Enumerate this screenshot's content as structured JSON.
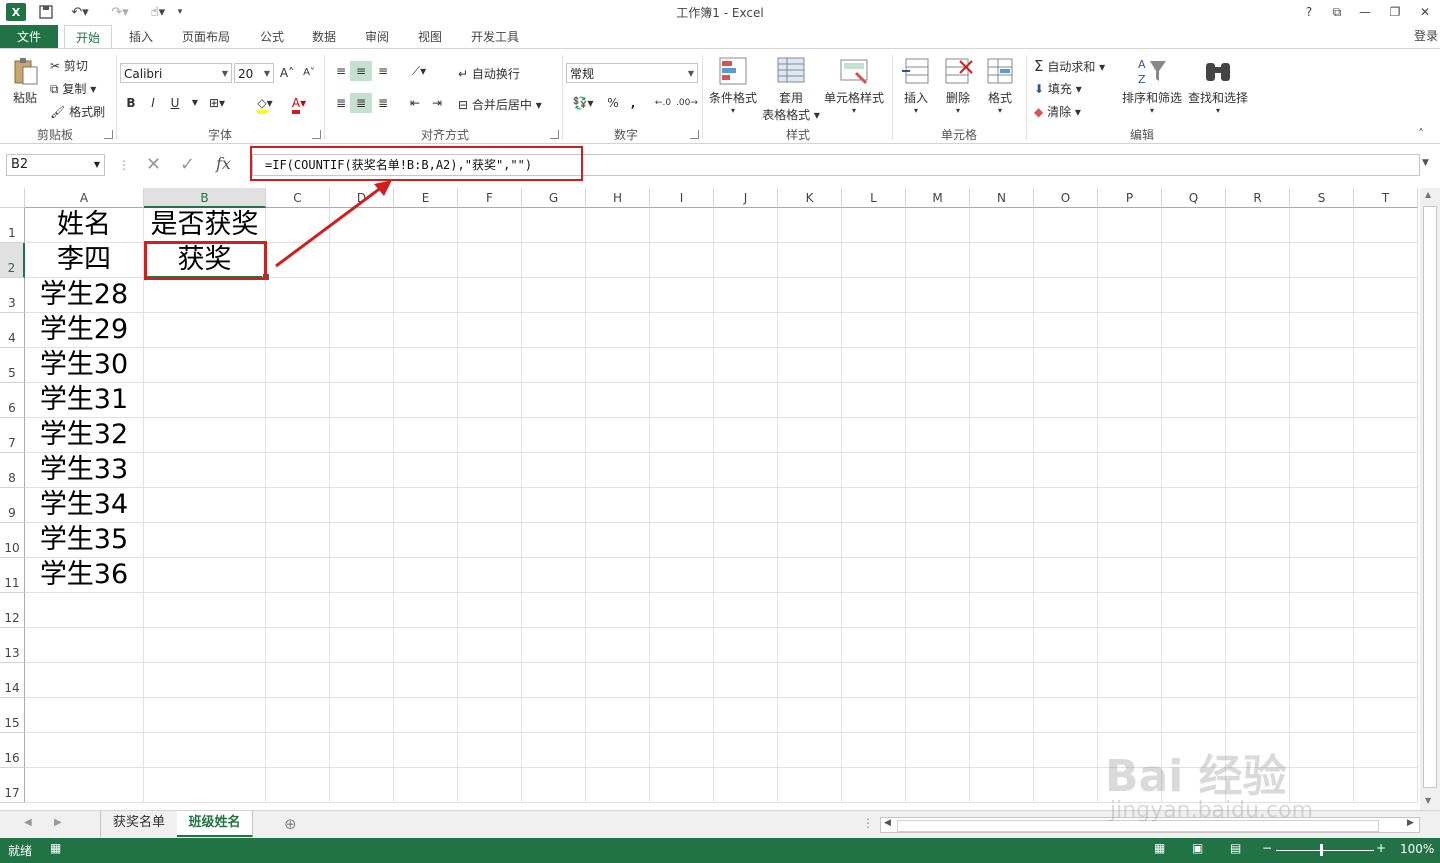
{
  "window": {
    "title": "工作簿1 - Excel",
    "help": "?",
    "login": "登录"
  },
  "tabs": [
    "文件",
    "开始",
    "插入",
    "页面布局",
    "公式",
    "数据",
    "审阅",
    "视图",
    "开发工具"
  ],
  "ribbon": {
    "clipboard": {
      "paste": "粘贴",
      "cut": "剪切",
      "copy": "复制",
      "format_painter": "格式刷",
      "label": "剪贴板"
    },
    "font": {
      "name": "Calibri",
      "size": "20",
      "bold": "B",
      "italic": "I",
      "underline": "U",
      "label": "字体",
      "grow": "A",
      "shrink": "A"
    },
    "alignment": {
      "wrap": "自动换行",
      "merge": "合并后居中",
      "label": "对齐方式"
    },
    "number": {
      "format": "常规",
      "percent": "%",
      "comma": ",",
      "label": "数字"
    },
    "styles": {
      "conditional": "条件格式",
      "table_line1": "套用",
      "table_line2": "表格格式",
      "cell_styles": "单元格样式",
      "label": "样式"
    },
    "cells": {
      "insert": "插入",
      "delete": "删除",
      "format": "格式",
      "label": "单元格"
    },
    "editing": {
      "autosum": "自动求和",
      "fill": "填充",
      "clear": "清除",
      "sort": "排序和筛选",
      "find": "查找和选择",
      "label": "编辑"
    }
  },
  "formula_bar": {
    "name_box": "B2",
    "fx": "fx",
    "formula": "=IF(COUNTIF(获奖名单!B:B,A2),\"获奖\",\"\")"
  },
  "columns": [
    "A",
    "B",
    "C",
    "D",
    "E",
    "F",
    "G",
    "H",
    "I",
    "J",
    "K",
    "L",
    "M",
    "N",
    "O",
    "P",
    "Q",
    "R",
    "S",
    "T"
  ],
  "rows": [
    "1",
    "2",
    "3",
    "4",
    "5",
    "6",
    "7",
    "8",
    "9",
    "10",
    "11",
    "12",
    "13",
    "14",
    "15",
    "16",
    "17"
  ],
  "cells": {
    "A": [
      "姓名",
      "李四",
      "学生28",
      "学生29",
      "学生30",
      "学生31",
      "学生32",
      "学生33",
      "学生34",
      "学生35",
      "学生36"
    ],
    "B": [
      "是否获奖",
      "获奖"
    ]
  },
  "sheets": {
    "tab1": "获奖名单",
    "tab2": "班级姓名",
    "active": "班级姓名"
  },
  "status": {
    "ready": "就绪",
    "zoom": "100%"
  },
  "watermark": {
    "main": "Bai 经验",
    "sub": "jingyan.baidu.com"
  },
  "colors": {
    "accent": "#217346",
    "highlight": "#d01f1f"
  }
}
